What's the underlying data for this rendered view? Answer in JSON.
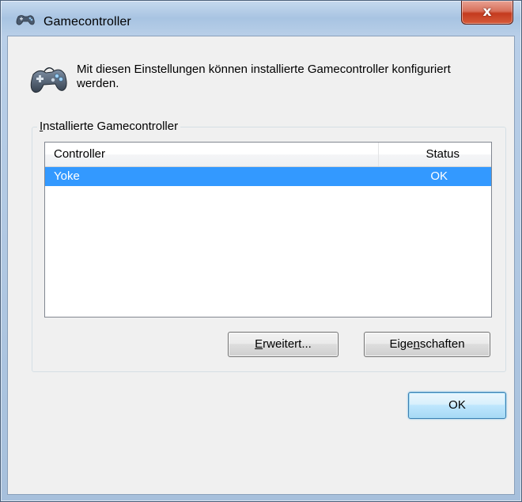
{
  "window": {
    "title": "Gamecontroller",
    "close_label": "x"
  },
  "intro": {
    "text": "Mit diesen Einstellungen können installierte Gamecontroller konfiguriert werden."
  },
  "group": {
    "label_accesskey": "I",
    "label_rest": "nstallierte Gamecontroller"
  },
  "table": {
    "columns": [
      "Controller",
      "Status"
    ],
    "rows": [
      {
        "controller": "Yoke",
        "status": "OK",
        "selected": true
      }
    ]
  },
  "buttons": {
    "advanced": {
      "accesskey": "E",
      "rest": "rweitert..."
    },
    "properties": {
      "before": "Eige",
      "accesskey": "n",
      "after": "schaften"
    },
    "ok": {
      "label": "OK"
    }
  },
  "colors": {
    "selection": "#3399ff",
    "dialog_bg": "#f0f0f0",
    "close_red": "#c43a1e"
  },
  "icons": {
    "title": "gamepad-icon",
    "header": "gamepad-icon"
  }
}
